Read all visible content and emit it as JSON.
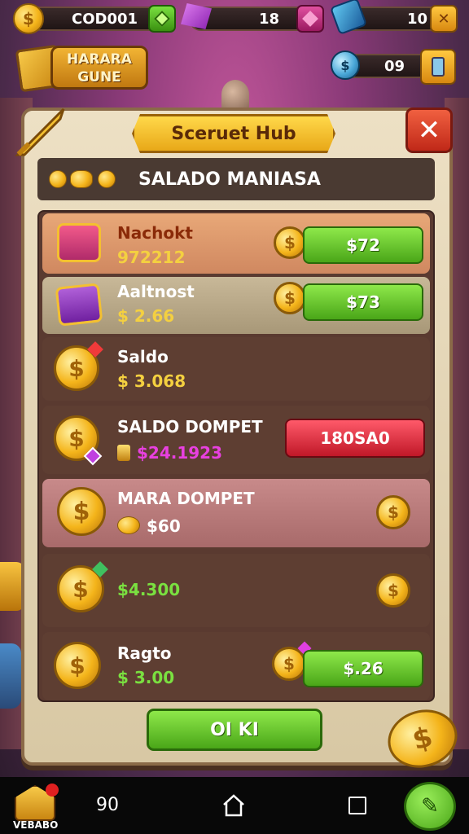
{
  "hud": {
    "coins_value": "COD001",
    "gems_value": "18",
    "tickets_value": "10",
    "secondary_value": "09"
  },
  "logo": {
    "line1": "HARARA",
    "line2": "GUNE"
  },
  "panel": {
    "title": "Sceruet Hub",
    "header_title": "SALADO MANIASA"
  },
  "rows": [
    {
      "name": "Nachokt",
      "value": "972212",
      "button": "$72",
      "icon": "treasure-chest-icon"
    },
    {
      "name": "Aaltnost",
      "value": "$ 2.66",
      "button": "$73",
      "icon": "purple-chest-icon"
    },
    {
      "name": "Saldo",
      "value": "$ 3.068",
      "icon": "coin-icon"
    },
    {
      "name": "SALDO DOMPET",
      "value": "$24.1923",
      "button": "180SA0",
      "icon": "coin-icon"
    },
    {
      "name": "MARA DOMPET",
      "value": "$60",
      "icon": "coin-icon"
    },
    {
      "name": "",
      "value": "$4.300",
      "icon": "coin-icon"
    },
    {
      "name": "Ragto",
      "value": "$ 3.00",
      "button": "$.26",
      "icon": "coin-icon"
    }
  ],
  "ok_button": "OI KI",
  "nav": {
    "left_label": "VEBABO",
    "counter": "90"
  },
  "colors": {
    "accent_gold": "#f4b41a",
    "button_green": "#5ab822",
    "button_red": "#d81f30",
    "panel_bg": "#e6d7b8"
  }
}
